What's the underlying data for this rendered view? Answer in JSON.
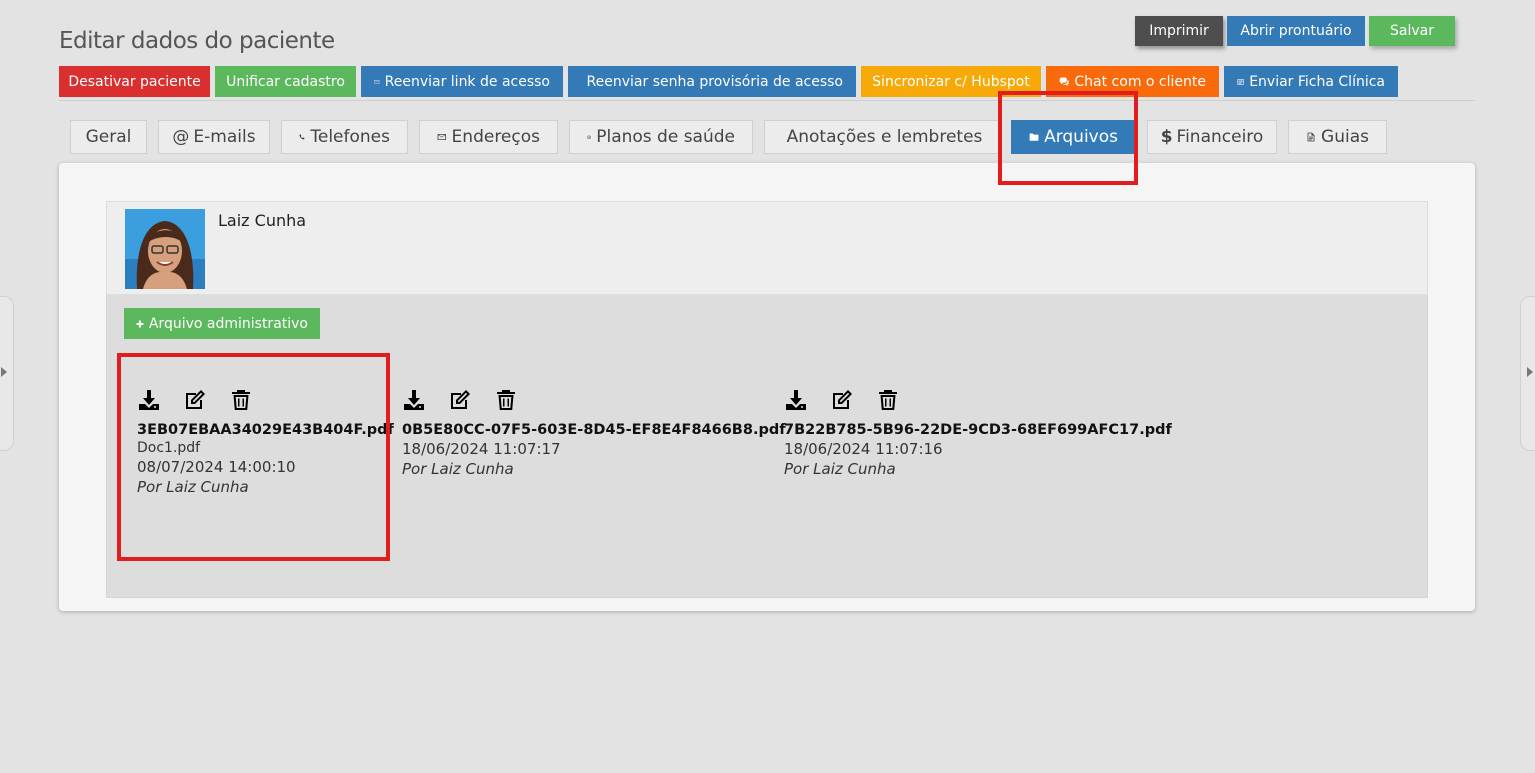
{
  "page": {
    "title": "Editar dados do paciente"
  },
  "top_actions": {
    "print": "Imprimir",
    "open_record": "Abrir prontuário",
    "save": "Salvar"
  },
  "actions": [
    {
      "label": "Desativar paciente",
      "color": "#d9302f"
    },
    {
      "label": "Unificar cadastro",
      "color": "#5cb85c"
    },
    {
      "label": "Reenviar link de acesso",
      "color": "#337ab7",
      "icon": "envelope-icon"
    },
    {
      "label": "Reenviar senha provisória de acesso",
      "color": "#337ab7",
      "icon": "user-plus-icon"
    },
    {
      "label": "Sincronizar c/ Hubspot",
      "color": "#f7a90a"
    },
    {
      "label": "Chat com o cliente",
      "color": "#f96a0c",
      "icon": "chat-icon"
    },
    {
      "label": "Enviar Ficha Clínica",
      "color": "#337ab7",
      "icon": "id-card-icon"
    }
  ],
  "tabs": [
    {
      "label": "Geral"
    },
    {
      "label": "E-mails",
      "icon": "at-icon"
    },
    {
      "label": "Telefones",
      "icon": "phone-icon"
    },
    {
      "label": "Endereços",
      "icon": "envelope-icon"
    },
    {
      "label": "Planos de saúde",
      "icon": "medkit-icon"
    },
    {
      "label": "Anotações e lembretes",
      "icon": "bell-icon"
    },
    {
      "label": "Arquivos",
      "icon": "folder-icon",
      "active": true
    },
    {
      "label": "Financeiro",
      "icon": "dollar-icon"
    },
    {
      "label": "Guias",
      "icon": "document-icon"
    }
  ],
  "patient": {
    "name": "Laiz Cunha"
  },
  "files_section": {
    "add_button": "Arquivo administrativo",
    "files": [
      {
        "name": "3EB07EBAA34029E43B404F.pdf",
        "label": "Doc1.pdf",
        "date": "08/07/2024 14:00:10",
        "author": "Por Laiz Cunha"
      },
      {
        "name": "0B5E80CC-07F5-603E-8D45-EF8E4F8466B8.pdf",
        "date": "18/06/2024 11:07:17",
        "author": "Por Laiz Cunha"
      },
      {
        "name": "7B22B785-5B96-22DE-9CD3-68EF699AFC17.pdf",
        "date": "18/06/2024 11:07:16",
        "author": "Por Laiz Cunha"
      }
    ]
  },
  "colors": {
    "highlight": "#e11d1d",
    "primary": "#337ab7",
    "success": "#5cb85c"
  }
}
